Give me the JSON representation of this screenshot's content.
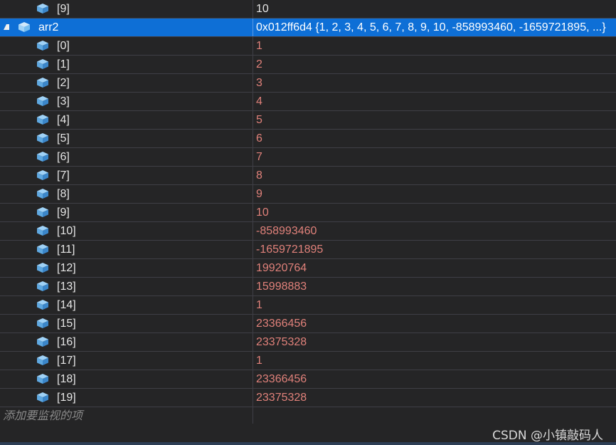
{
  "watch": {
    "top_row": {
      "name": "[9]",
      "value": "10"
    },
    "parent": {
      "name": "arr2",
      "value": "0x012ff6d4 {1, 2, 3, 4, 5, 6, 7, 8, 9, 10, -858993460, -1659721895, ...}"
    },
    "children": [
      {
        "name": "[0]",
        "value": "1"
      },
      {
        "name": "[1]",
        "value": "2"
      },
      {
        "name": "[2]",
        "value": "3"
      },
      {
        "name": "[3]",
        "value": "4"
      },
      {
        "name": "[4]",
        "value": "5"
      },
      {
        "name": "[5]",
        "value": "6"
      },
      {
        "name": "[6]",
        "value": "7"
      },
      {
        "name": "[7]",
        "value": "8"
      },
      {
        "name": "[8]",
        "value": "9"
      },
      {
        "name": "[9]",
        "value": "10"
      },
      {
        "name": "[10]",
        "value": "-858993460"
      },
      {
        "name": "[11]",
        "value": "-1659721895"
      },
      {
        "name": "[12]",
        "value": "19920764"
      },
      {
        "name": "[13]",
        "value": "15998883"
      },
      {
        "name": "[14]",
        "value": "1"
      },
      {
        "name": "[15]",
        "value": "23366456"
      },
      {
        "name": "[16]",
        "value": "23375328"
      },
      {
        "name": "[17]",
        "value": "1"
      },
      {
        "name": "[18]",
        "value": "23366456"
      },
      {
        "name": "[19]",
        "value": "23375328"
      }
    ],
    "add_placeholder": "添加要监视的项"
  },
  "watermark": "CSDN @小镇敲码人",
  "colors": {
    "background": "#252526",
    "selected": "#0e6fd6",
    "value_text": "#e0817a",
    "icon": "#75bdf0"
  },
  "icons": {
    "variable": "cube-icon",
    "expander": "collapse-triangle-icon"
  }
}
